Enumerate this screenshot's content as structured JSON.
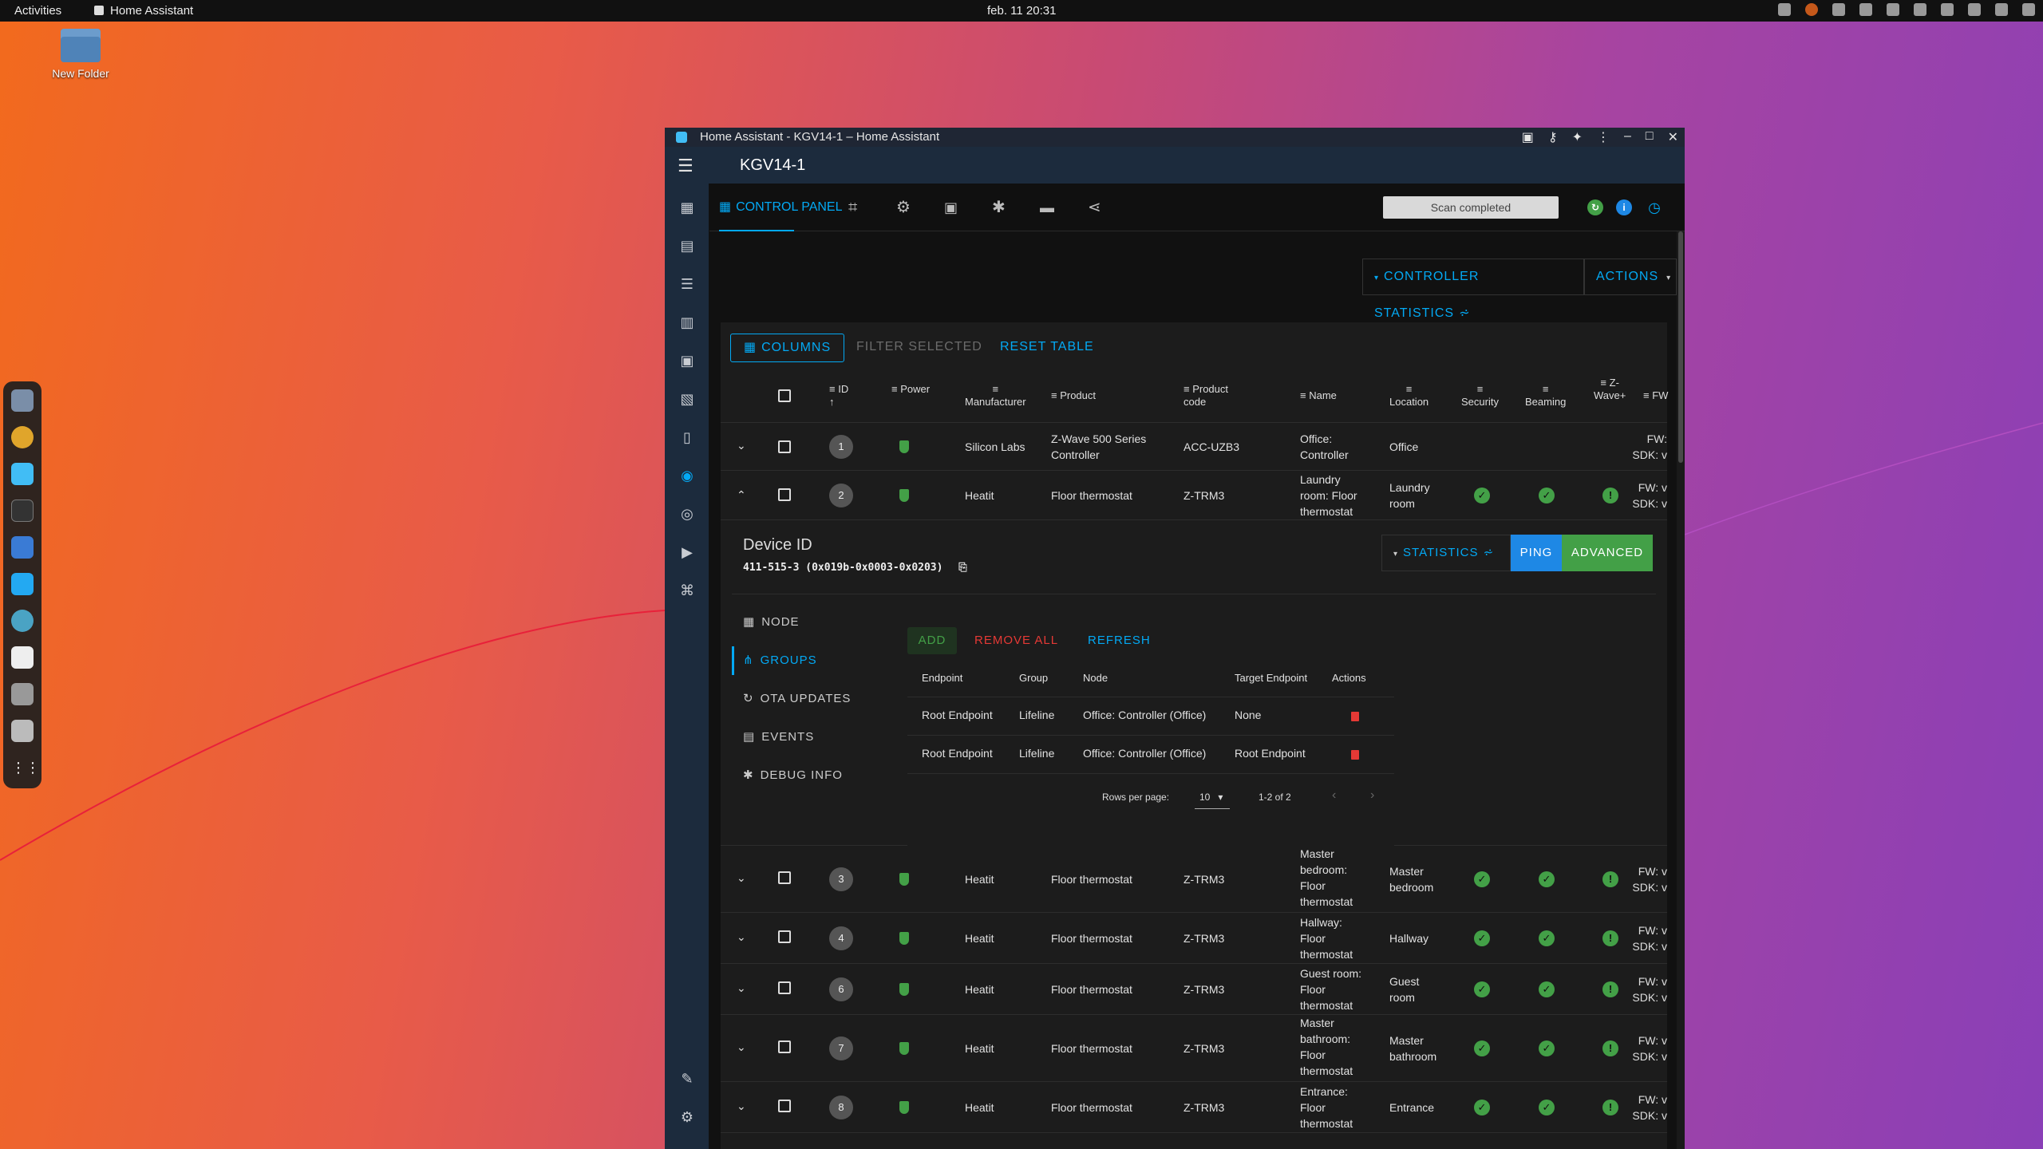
{
  "os": {
    "activities": "Activities",
    "app_name": "Home Assistant",
    "clock": "feb. 11  20:31"
  },
  "desktop": {
    "folder_label": "New Folder"
  },
  "window": {
    "title": "Home Assistant - KGV14-1 – Home Assistant",
    "page_title": "KGV14-1"
  },
  "tabs": {
    "control_panel": "CONTROL PANEL"
  },
  "scan_status": "Scan completed",
  "toolbar": {
    "controller_statistics": "CONTROLLER STATISTICS",
    "actions": "ACTIONS",
    "columns": "COLUMNS",
    "filter_selected": "FILTER SELECTED",
    "reset_table": "RESET TABLE"
  },
  "columns": {
    "id": "ID",
    "power": "Power",
    "manufacturer": "Manufacturer",
    "product": "Product",
    "product_code_1": "Product",
    "product_code_2": "code",
    "name": "Name",
    "location": "Location",
    "security": "Security",
    "beaming": "Beaming",
    "zwave_1": "Z-",
    "zwave_2": "Wave+",
    "fw": "FW"
  },
  "rows": [
    {
      "id": "1",
      "manufacturer": "Silicon Labs",
      "product_1": "Z-Wave 500 Series",
      "product_2": "Controller",
      "code": "ACC-UZB3",
      "name_1": "Office:",
      "name_2": "Controller",
      "name_3": "",
      "location_1": "Office",
      "location_2": "",
      "fw_1": "FW:",
      "fw_2": "SDK: v"
    },
    {
      "id": "2",
      "manufacturer": "Heatit",
      "product_1": "Floor thermostat",
      "product_2": "",
      "code": "Z-TRM3",
      "name_1": "Laundry",
      "name_2": "room: Floor",
      "name_3": "thermostat",
      "location_1": "Laundry",
      "location_2": "room",
      "fw_1": "FW: v",
      "fw_2": "SDK: v"
    },
    {
      "id": "3",
      "manufacturer": "Heatit",
      "product_1": "Floor thermostat",
      "product_2": "",
      "code": "Z-TRM3",
      "name_1": "Master",
      "name_2": "bedroom:",
      "name_3": "Floor",
      "name_4": "thermostat",
      "location_1": "Master",
      "location_2": "bedroom",
      "fw_1": "FW: v",
      "fw_2": "SDK: v"
    },
    {
      "id": "4",
      "manufacturer": "Heatit",
      "product_1": "Floor thermostat",
      "product_2": "",
      "code": "Z-TRM3",
      "name_1": "Hallway:",
      "name_2": "Floor",
      "name_3": "thermostat",
      "location_1": "Hallway",
      "location_2": "",
      "fw_1": "FW: v",
      "fw_2": "SDK: v"
    },
    {
      "id": "6",
      "manufacturer": "Heatit",
      "product_1": "Floor thermostat",
      "product_2": "",
      "code": "Z-TRM3",
      "name_1": "Guest room:",
      "name_2": "Floor",
      "name_3": "thermostat",
      "location_1": "Guest",
      "location_2": "room",
      "fw_1": "FW: v",
      "fw_2": "SDK: v"
    },
    {
      "id": "7",
      "manufacturer": "Heatit",
      "product_1": "Floor thermostat",
      "product_2": "",
      "code": "Z-TRM3",
      "name_1": "Master",
      "name_2": "bathroom:",
      "name_3": "Floor",
      "name_4": "thermostat",
      "location_1": "Master",
      "location_2": "bathroom",
      "fw_1": "FW: v",
      "fw_2": "SDK: v"
    },
    {
      "id": "8",
      "manufacturer": "Heatit",
      "product_1": "Floor thermostat",
      "product_2": "",
      "code": "Z-TRM3",
      "name_1": "Entrance:",
      "name_2": "Floor",
      "name_3": "thermostat",
      "location_1": "Entrance",
      "location_2": "",
      "fw_1": "FW: v",
      "fw_2": "SDK: v"
    }
  ],
  "device": {
    "label": "Device ID",
    "id": "411-515-3 (0x019b-0x0003-0x0203)",
    "statistics": "STATISTICS",
    "ping": "PING",
    "advanced": "ADVANCED"
  },
  "device_nav": {
    "node": "NODE",
    "groups": "GROUPS",
    "ota": "OTA UPDATES",
    "events": "EVENTS",
    "debug": "DEBUG INFO"
  },
  "groups": {
    "add": "ADD",
    "remove_all": "REMOVE ALL",
    "refresh": "REFRESH",
    "headers": {
      "endpoint": "Endpoint",
      "group": "Group",
      "node": "Node",
      "target": "Target Endpoint",
      "actions": "Actions"
    },
    "rows": [
      {
        "endpoint": "Root Endpoint",
        "group": "Lifeline",
        "node": "Office: Controller (Office)",
        "target": "None"
      },
      {
        "endpoint": "Root Endpoint",
        "group": "Lifeline",
        "node": "Office: Controller (Office)",
        "target": "Root Endpoint"
      }
    ],
    "rows_per_page_label": "Rows per page:",
    "rows_per_page": "10",
    "range": "1-2 of 2"
  },
  "colors": {
    "accent": "#03a9f4",
    "success": "#43a047",
    "danger": "#e53935",
    "appbar": "#1c2b3d"
  }
}
